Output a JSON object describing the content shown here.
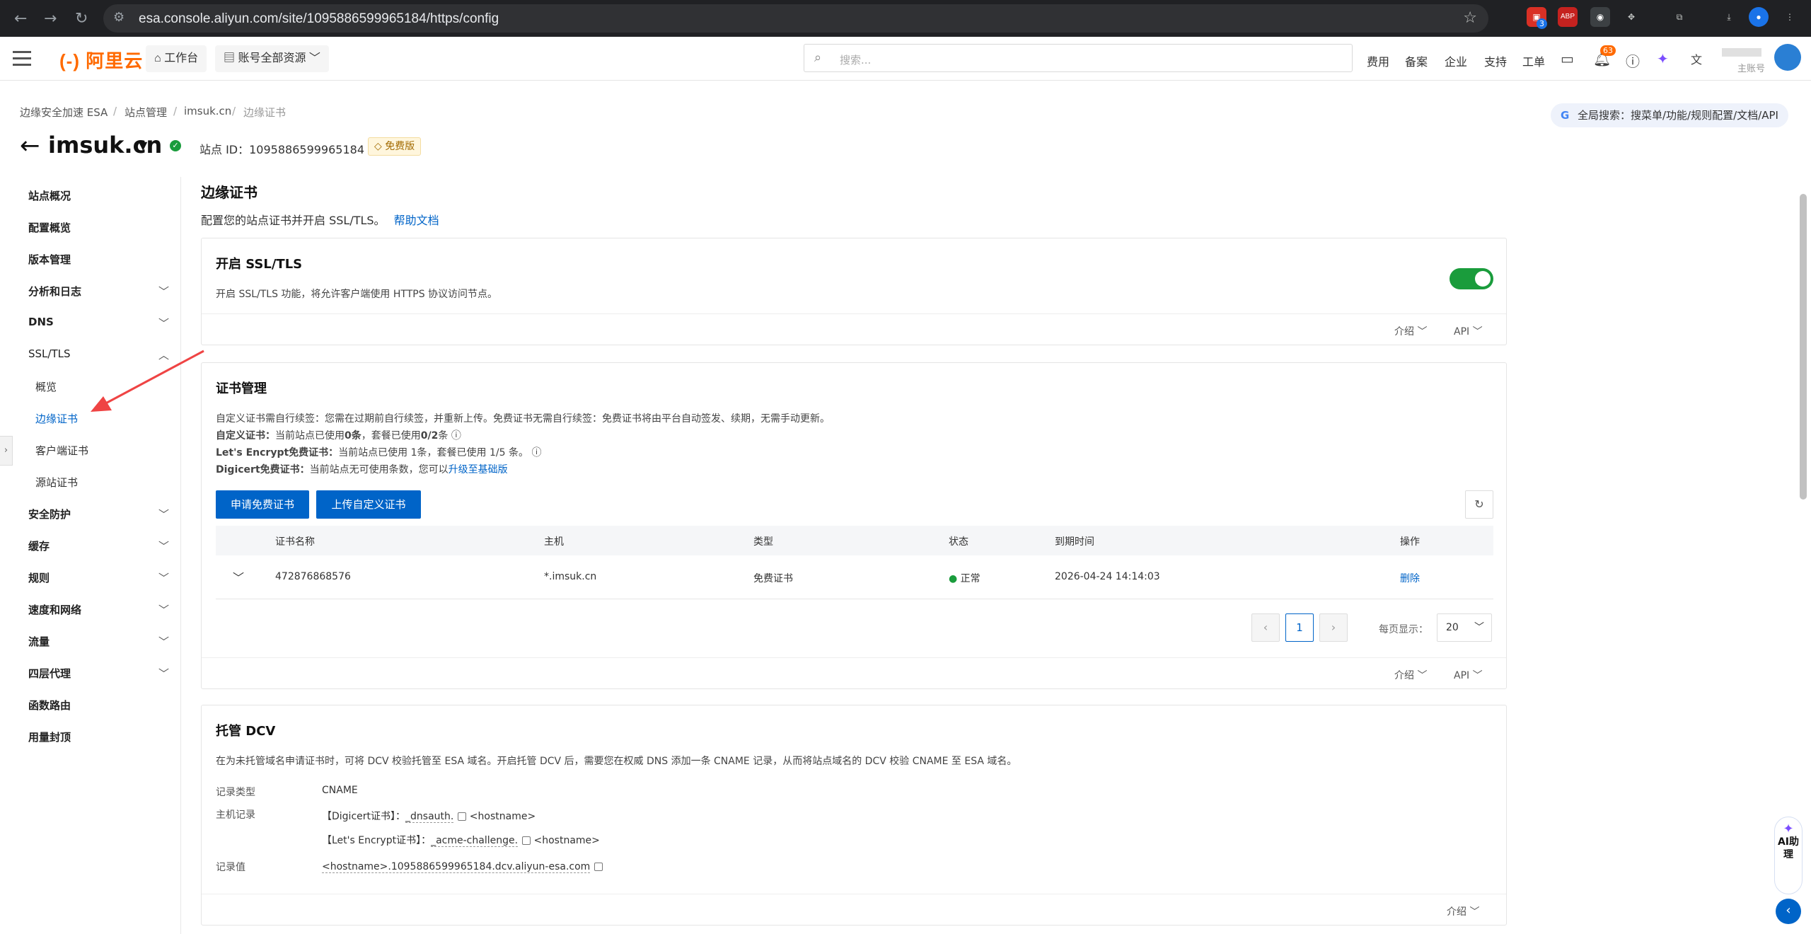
{
  "browser": {
    "url": "esa.console.aliyun.com/site/1095886599965184/https/config",
    "ext_badge": "3",
    "ext_abp": "ABP"
  },
  "header": {
    "logo": "(-) 阿里云",
    "workbench": "工作台",
    "resources": "账号全部资源",
    "search_placeholder": "搜索...",
    "links": [
      "费用",
      "备案",
      "企业",
      "支持",
      "工单"
    ],
    "notif_count": "63",
    "account_label": "主账号"
  },
  "breadcrumb": [
    "边缘安全加速 ESA",
    "站点管理",
    "imsuk.cn",
    "边缘证书"
  ],
  "global_search": "全局搜索：搜菜单/功能/规则配置/文档/API",
  "site": {
    "name": "imsuk.cn",
    "id_label": "站点 ID：1095886599965184",
    "plan": "免费版"
  },
  "sidebar": {
    "items": [
      {
        "label": "站点概况"
      },
      {
        "label": "配置概览"
      },
      {
        "label": "版本管理"
      },
      {
        "label": "分析和日志",
        "chevron": "﹀"
      },
      {
        "label": "DNS",
        "chevron": "﹀"
      },
      {
        "label": "SSL/TLS",
        "chevron": "︿"
      },
      {
        "label": "概览"
      },
      {
        "label": "边缘证书"
      },
      {
        "label": "客户端证书"
      },
      {
        "label": "源站证书"
      },
      {
        "label": "安全防护",
        "chevron": "﹀"
      },
      {
        "label": "缓存",
        "chevron": "﹀"
      },
      {
        "label": "规则",
        "chevron": "﹀"
      },
      {
        "label": "速度和网络",
        "chevron": "﹀"
      },
      {
        "label": "流量",
        "chevron": "﹀"
      },
      {
        "label": "四层代理",
        "chevron": "﹀"
      },
      {
        "label": "函数路由"
      },
      {
        "label": "用量封顶"
      }
    ]
  },
  "main": {
    "title": "边缘证书",
    "desc": "配置您的站点证书并开启 SSL/TLS。",
    "help": "帮助文档"
  },
  "ssl_card": {
    "title": "开启 SSL/TLS",
    "desc": "开启 SSL/TLS 功能，将允许客户端使用 HTTPS 协议访问节点。",
    "toggle_on": true,
    "intro": "介绍 ﹀",
    "api": "API ﹀"
  },
  "cert_card": {
    "title": "证书管理",
    "line1": "自定义证书需自行续签：您需在过期前自行续签，并重新上传。免费证书无需自行续签：免费证书将由平台自动签发、续期，无需手动更新。",
    "line2_label": "自定义证书：",
    "line2_a": "当前站点已使用",
    "line2_b": "0条",
    "line2_c": "，套餐已使用",
    "line2_d": "0/2",
    "line2_e": "条",
    "line3_label": "Let's Encrypt免费证书：",
    "line3": "当前站点已使用 1条，套餐已使用 1/5 条。",
    "line4_label": "Digicert免费证书：",
    "line4": "当前站点无可使用条数，您可以",
    "line4_link": "升级至基础版",
    "btn_apply": "申请免费证书",
    "btn_upload": "上传自定义证书",
    "columns": [
      "证书名称",
      "主机",
      "类型",
      "状态",
      "到期时间",
      "操作"
    ],
    "row": {
      "name": "472876868576",
      "host": "*.imsuk.cn",
      "type": "免费证书",
      "status": "正常",
      "expire": "2026-04-24 14:14:03",
      "action": "删除"
    },
    "page": "1",
    "page_size_label": "每页显示：",
    "page_size": "20",
    "intro": "介绍 ﹀",
    "api": "API ﹀"
  },
  "dcv_card": {
    "title": "托管 DCV",
    "desc": "在为未托管域名申请证书时，可将 DCV 校验托管至 ESA 域名。开启托管 DCV 后，需要您在权威 DNS 添加一条 CNAME 记录，从而将站点域名的 DCV 校验 CNAME 至 ESA 域名。",
    "record_type_label": "记录类型",
    "record_type": "CNAME",
    "host_label": "主机记录",
    "digicert_prefix": "【Digicert证书】：",
    "digicert_value": "_dnsauth.",
    "digicert_suffix": "<hostname>",
    "le_prefix": "【Let's Encrypt证书】：",
    "le_value": "_acme-challenge.",
    "le_suffix": "<hostname>",
    "value_label": "记录值",
    "value": "<hostname>.1095886599965184.dcv.aliyun-esa.com",
    "intro": "介绍 ﹀"
  },
  "ai_assistant": "AI助理"
}
